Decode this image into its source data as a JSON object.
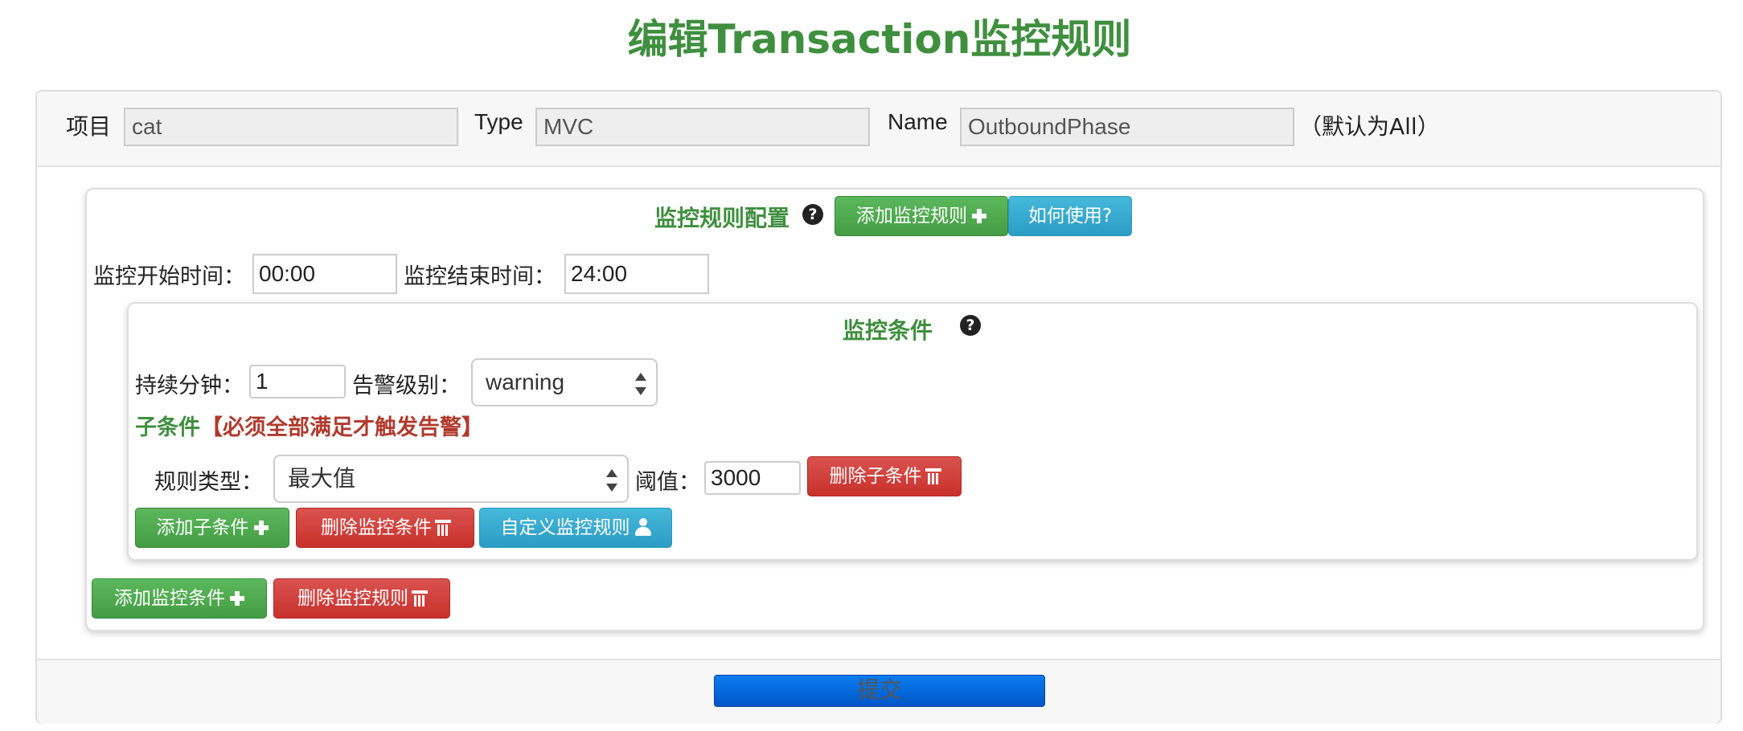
{
  "page_title": "编辑Transaction监控规则",
  "top_bar": {
    "project_label": "项目",
    "project_value": "cat",
    "type_label": "Type",
    "type_value": "MVC",
    "name_label": "Name",
    "name_value": "OutboundPhase",
    "name_hint": "（默认为All）"
  },
  "rule_config": {
    "title": "监控规则配置",
    "help_icon": "question-circle-icon",
    "add_rule_label": "添加监控规则",
    "how_to_label": "如何使用?",
    "start_label": "监控开始时间：",
    "start_value": "00:00",
    "end_label": "监控结束时间：",
    "end_value": "24:00"
  },
  "condition": {
    "title": "监控条件",
    "duration_label": "持续分钟：",
    "duration_value": "1",
    "level_label": "告警级别：",
    "level_value": "warning",
    "sub_title_green": "子条件",
    "sub_title_red": "【必须全部满足才触发告警】",
    "rule_type_label": "规则类型：",
    "rule_type_value": "最大值",
    "threshold_label": "阈值：",
    "threshold_value": "3000",
    "delete_sub_label": "删除子条件",
    "add_sub_label": "添加子条件",
    "delete_condition_label": "删除监控条件",
    "custom_rule_label": "自定义监控规则"
  },
  "footer_actions": {
    "add_condition_label": "添加监控条件",
    "delete_rule_label": "删除监控规则",
    "submit_label": "提交"
  },
  "colors": {
    "title_green": "#3f8f3f",
    "warning_red": "#b03a2e",
    "btn_green": "#5cb85c",
    "btn_blue": "#46b8da",
    "btn_red": "#d9534f",
    "submit_blue": "#0a7df0"
  }
}
